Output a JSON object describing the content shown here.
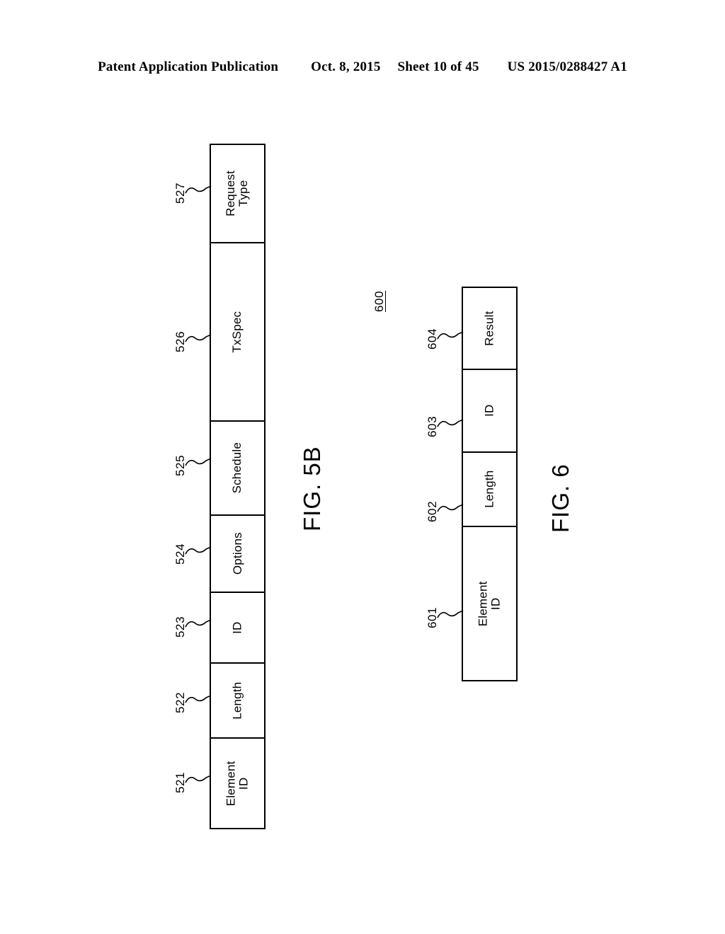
{
  "header": {
    "publication": "Patent Application Publication",
    "date": "Oct. 8, 2015",
    "sheet": "Sheet 10 of 45",
    "patent_number": "US 2015/0288427 A1"
  },
  "figures": [
    {
      "caption": "FIG. 5B",
      "fields": [
        {
          "ref": "521",
          "label_line1": "Element",
          "label_line2": "ID"
        },
        {
          "ref": "522",
          "label_line1": "Length",
          "label_line2": ""
        },
        {
          "ref": "523",
          "label_line1": "ID",
          "label_line2": ""
        },
        {
          "ref": "524",
          "label_line1": "Options",
          "label_line2": ""
        },
        {
          "ref": "525",
          "label_line1": "Schedule",
          "label_line2": ""
        },
        {
          "ref": "526",
          "label_line1": "TxSpec",
          "label_line2": ""
        },
        {
          "ref": "527",
          "label_line1": "Request",
          "label_line2": "Type"
        }
      ]
    },
    {
      "caption": "FIG. 6",
      "diagram_ref": "600",
      "fields": [
        {
          "ref": "601",
          "label_line1": "Element",
          "label_line2": "ID"
        },
        {
          "ref": "602",
          "label_line1": "Length",
          "label_line2": ""
        },
        {
          "ref": "603",
          "label_line1": "ID",
          "label_line2": ""
        },
        {
          "ref": "604",
          "label_line1": "Result",
          "label_line2": ""
        }
      ]
    }
  ],
  "colors": {
    "ink": "#000000",
    "paper": "#ffffff"
  }
}
